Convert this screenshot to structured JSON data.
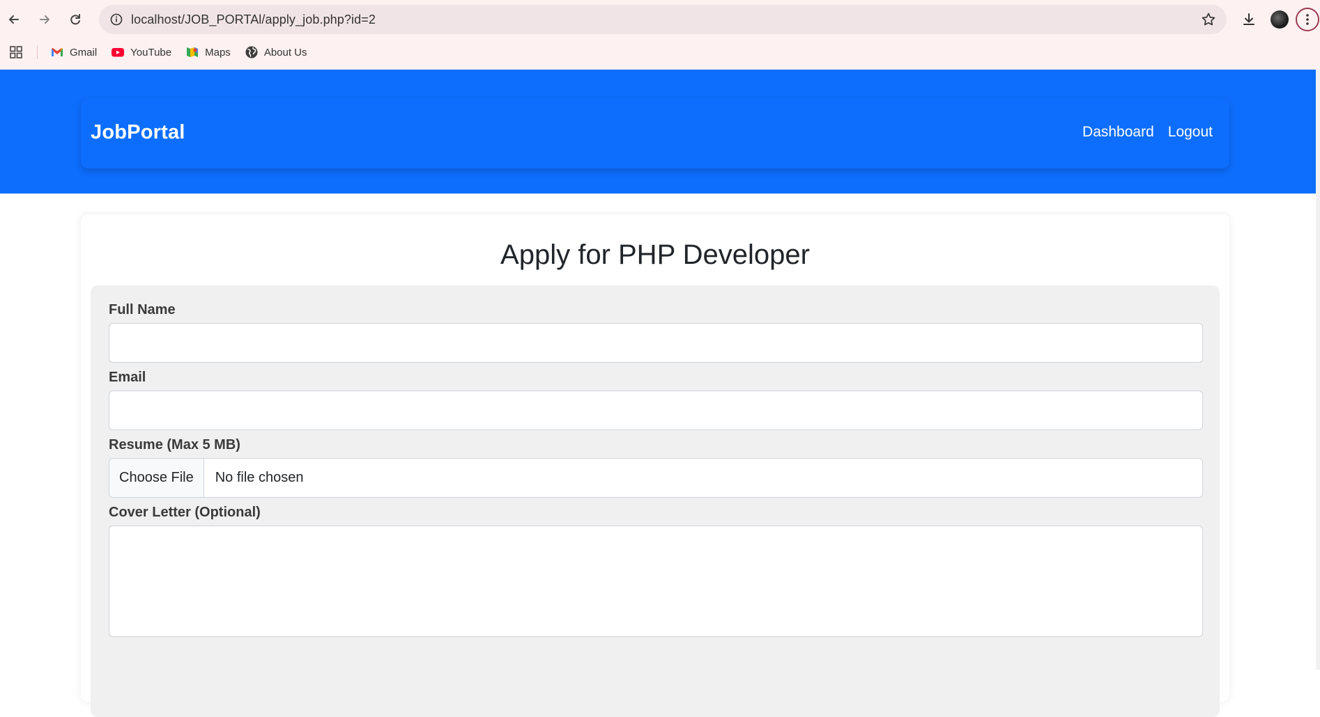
{
  "browser": {
    "url": "localhost/JOB_PORTAl/apply_job.php?id=2",
    "bookmarks": [
      {
        "label": "Gmail",
        "icon": "gmail-icon"
      },
      {
        "label": "YouTube",
        "icon": "youtube-icon"
      },
      {
        "label": "Maps",
        "icon": "maps-icon"
      },
      {
        "label": "About Us",
        "icon": "globe-icon"
      }
    ]
  },
  "navbar": {
    "brand": "JobPortal",
    "links": [
      "Dashboard",
      "Logout"
    ],
    "color": "#0d6efd"
  },
  "form": {
    "title": "Apply for PHP Developer",
    "full_name_label": "Full Name",
    "full_name_value": "",
    "email_label": "Email",
    "email_value": "",
    "resume_label": "Resume (Max 5 MB)",
    "choose_file_label": "Choose File",
    "file_status": "No file chosen",
    "cover_letter_label": "Cover Letter (Optional)",
    "cover_letter_value": ""
  }
}
